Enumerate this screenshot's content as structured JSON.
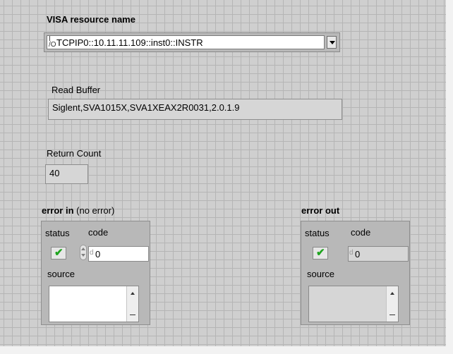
{
  "visa": {
    "label": "VISA resource name",
    "icon_glyph": "I/O",
    "value": "TCPIP0::10.11.11.109::inst0::INSTR"
  },
  "read_buffer": {
    "label": "Read Buffer",
    "value": "Siglent,SVA1015X,SVA1XEAX2R0031,2.0.1.9"
  },
  "return_count": {
    "label": "Return Count",
    "value": "40"
  },
  "error_in": {
    "label": "error in",
    "sub_label": "(no error)",
    "status_label": "status",
    "code_label": "code",
    "code_value": "0",
    "radix": "d",
    "source_label": "source",
    "status_checked": true
  },
  "error_out": {
    "label": "error out",
    "status_label": "status",
    "code_label": "code",
    "code_value": "0",
    "radix": "d",
    "source_label": "source",
    "status_checked": true
  },
  "icons": {
    "check": "✔",
    "visa_resource": "visa-resource-icon",
    "dropdown": "chevron-down-icon"
  },
  "colors": {
    "panel": "#cfcfcf",
    "grid": "#b5b5b5",
    "check_green": "#1ea41e"
  }
}
